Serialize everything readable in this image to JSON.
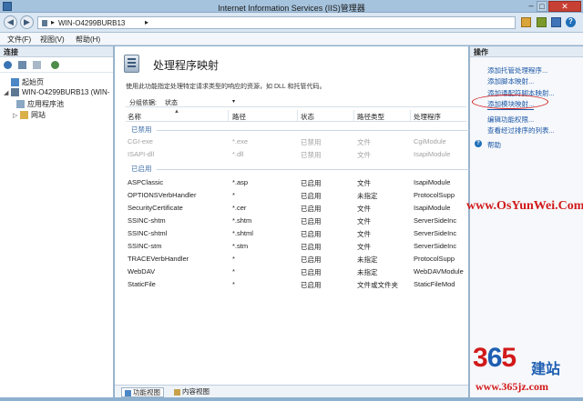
{
  "window": {
    "title": "Internet Information Services (IIS)管理器",
    "minimize": "–",
    "maximize": "□",
    "close": "✕"
  },
  "address": {
    "back": "◀",
    "forward": "▶",
    "sep": "▸",
    "server": "WIN-O4299BURB13",
    "help": "?"
  },
  "menu": {
    "file": "文件(F)",
    "view": "视图(V)",
    "help": "帮助(H)"
  },
  "connections": {
    "title": "连接",
    "tree": [
      {
        "label": "起始页"
      },
      {
        "label": "WIN-O4299BURB13 (WIN-"
      },
      {
        "label": "应用程序池"
      },
      {
        "label": "网站"
      }
    ]
  },
  "main": {
    "title": "处理程序映射",
    "description": "使用此功能指定处理特定请求类型的响应的资源，如 DLL 和托管代码。",
    "group_by_label": "分组依据:",
    "group_by_value": "状态",
    "caret": "▾",
    "columns": [
      "名称",
      "路径",
      "状态",
      "路径类型",
      "处理程序"
    ],
    "sort_arrow": "▲",
    "groups": [
      {
        "name": "已禁用",
        "rows": [
          {
            "name": "CGI-exe",
            "path": "*.exe",
            "state": "已禁用",
            "type": "文件",
            "handler": "CgiModule"
          },
          {
            "name": "ISAPI-dll",
            "path": "*.dll",
            "state": "已禁用",
            "type": "文件",
            "handler": "IsapiModule"
          }
        ]
      },
      {
        "name": "已启用",
        "rows": [
          {
            "name": "ASPClassic",
            "path": "*.asp",
            "state": "已启用",
            "type": "文件",
            "handler": "IsapiModule"
          },
          {
            "name": "OPTIONSVerbHandler",
            "path": "*",
            "state": "已启用",
            "type": "未指定",
            "handler": "ProtocolSupp"
          },
          {
            "name": "SecurityCertificate",
            "path": "*.cer",
            "state": "已启用",
            "type": "文件",
            "handler": "IsapiModule"
          },
          {
            "name": "SSINC-shtm",
            "path": "*.shtm",
            "state": "已启用",
            "type": "文件",
            "handler": "ServerSideInc"
          },
          {
            "name": "SSINC-shtml",
            "path": "*.shtml",
            "state": "已启用",
            "type": "文件",
            "handler": "ServerSideInc"
          },
          {
            "name": "SSINC-stm",
            "path": "*.stm",
            "state": "已启用",
            "type": "文件",
            "handler": "ServerSideInc"
          },
          {
            "name": "TRACEVerbHandler",
            "path": "*",
            "state": "已启用",
            "type": "未指定",
            "handler": "ProtocolSupp"
          },
          {
            "name": "WebDAV",
            "path": "*",
            "state": "已启用",
            "type": "未指定",
            "handler": "WebDAVModule"
          },
          {
            "name": "StaticFile",
            "path": "*",
            "state": "已启用",
            "type": "文件或文件夹",
            "handler": "StaticFileMod"
          }
        ]
      }
    ]
  },
  "bottom_tabs": {
    "features": "功能视图",
    "content": "内容视图"
  },
  "actions": {
    "title": "操作",
    "links": [
      "添加托管处理程序...",
      "添加脚本映射...",
      "添加通配符脚本映射...",
      "添加模块映射...",
      "编辑功能权限...",
      "查看经过排序的列表...",
      "帮助"
    ],
    "highlighted_index": 3,
    "help_glyph": "?"
  },
  "watermark": {
    "url": "www.OsYunWei.Com",
    "logo_3": "3",
    "logo_6": "6",
    "logo_5": "5",
    "logo_cn": "建站",
    "logo_url": "www.365jz.com"
  },
  "colors": {
    "link": "#1a56a5",
    "group_title": "#3f6fa8",
    "disabled_text": "#a3a3a3",
    "watermark_red": "#d21a1a",
    "logo_blue": "#1f5fb2"
  },
  "icons": [
    "app-icon",
    "back-arrow-icon",
    "forward-arrow-icon",
    "server-icon",
    "refresh-icon",
    "stop-icon",
    "home-icon",
    "help-icon",
    "start-page-icon",
    "app-pools-icon",
    "sites-icon",
    "handler-mappings-icon",
    "features-view-icon",
    "content-view-icon"
  ]
}
